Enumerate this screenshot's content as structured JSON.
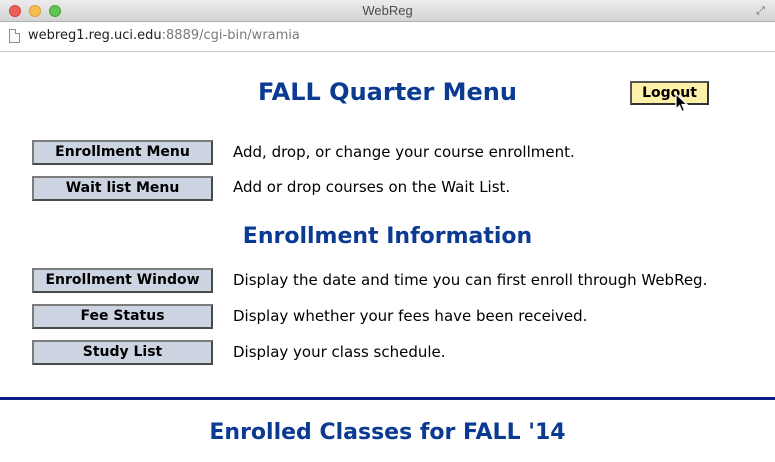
{
  "window": {
    "title": "WebReg",
    "fullscreen_icon": "fullscreen-icon"
  },
  "urlbar": {
    "host": "webreg1.reg.uci.edu",
    "path": ":8889/cgi-bin/wramia"
  },
  "header": {
    "title": "FALL Quarter Menu",
    "logout_label": "Logout"
  },
  "menu": [
    {
      "label": "Enrollment Menu",
      "description": "Add, drop, or change your course enrollment."
    },
    {
      "label": "Wait list Menu",
      "description": "Add or drop courses on the Wait List."
    }
  ],
  "info_section": {
    "title": "Enrollment Information",
    "items": [
      {
        "label": "Enrollment Window",
        "description": "Display the date and time you can first enroll through WebReg."
      },
      {
        "label": "Fee Status",
        "description": "Display whether your fees have been received."
      },
      {
        "label": "Study List",
        "description": "Display your class schedule."
      }
    ]
  },
  "enrolled": {
    "title": "Enrolled Classes for FALL '14"
  },
  "colors": {
    "heading": "#0b3a93",
    "button_bg": "#ccd4e2",
    "logout_bg": "#fdf0a8",
    "rule": "#0a1f86"
  }
}
